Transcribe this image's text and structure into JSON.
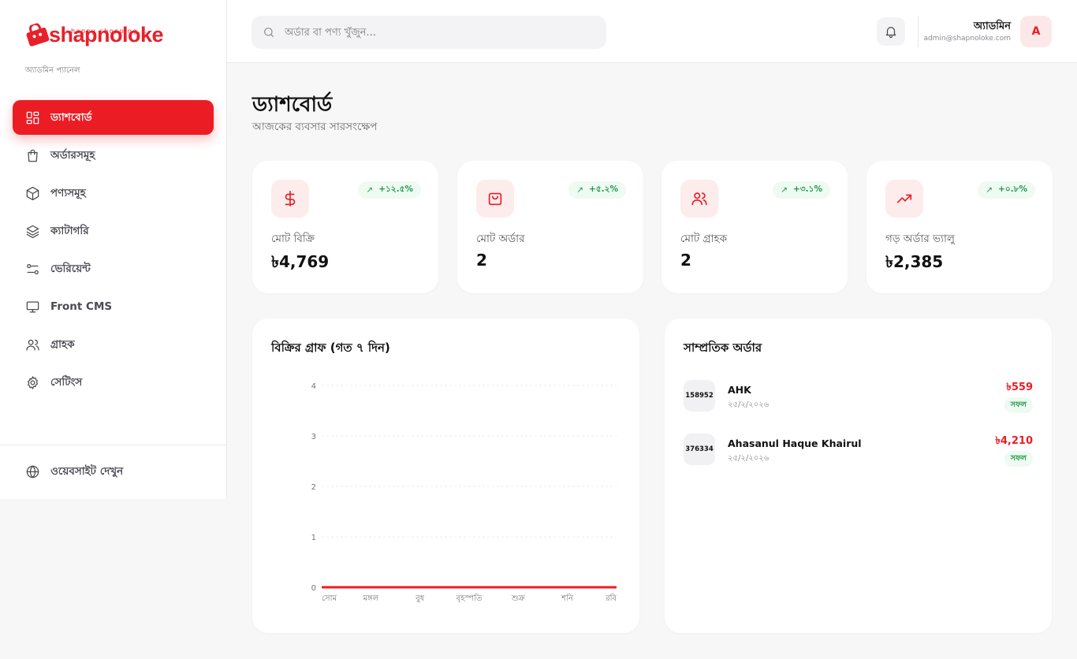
{
  "brand": {
    "name": "shapnoloke",
    "tagline": "happy shopping...",
    "panel_label": "অ্যাডমিন প্যানেল",
    "accent_color": "#ec1c24"
  },
  "sidebar": {
    "items": [
      {
        "label": "ড্যাশবোর্ড",
        "icon": "dashboard-grid-icon",
        "active": true
      },
      {
        "label": "অর্ডারসমূহ",
        "icon": "shopping-bag-icon",
        "active": false
      },
      {
        "label": "পণ্যসমূহ",
        "icon": "package-box-icon",
        "active": false
      },
      {
        "label": "ক্যাটাগরি",
        "icon": "layers-icon",
        "active": false
      },
      {
        "label": "ভেরিয়েন্ট",
        "icon": "variant-sliders-icon",
        "active": false
      },
      {
        "label": "Front CMS",
        "icon": "monitor-icon",
        "active": false
      },
      {
        "label": "গ্রাহক",
        "icon": "users-icon",
        "active": false
      },
      {
        "label": "সেটিংস",
        "icon": "gear-icon",
        "active": false
      }
    ],
    "visit_site": {
      "label": "ওয়েবসাইট দেখুন",
      "icon": "globe-icon"
    }
  },
  "header": {
    "search_placeholder": "অর্ডার বা পণ্য খুঁজুন...",
    "notification_icon": "bell-icon",
    "user": {
      "name": "অ্যাডমিন",
      "email": "admin@shapnoloke.com",
      "avatar_letter": "A"
    }
  },
  "page": {
    "title": "ড্যাশবোর্ড",
    "subtitle": "আজকের ব্যবসার সারসংক্ষেপ"
  },
  "stats": [
    {
      "label": "মোট বিক্রি",
      "value": "৳4,769",
      "trend": "+১২.৫%",
      "icon": "dollar-icon"
    },
    {
      "label": "মোট অর্ডার",
      "value": "2",
      "trend": "+৫.২%",
      "icon": "shopping-bag-icon"
    },
    {
      "label": "মোট গ্রাহক",
      "value": "2",
      "trend": "+৩.১%",
      "icon": "users-icon"
    },
    {
      "label": "গড় অর্ডার ভ্যালু",
      "value": "৳2,385",
      "trend": "+০.৮%",
      "icon": "trending-up-icon"
    }
  ],
  "chart_data": {
    "type": "line",
    "title": "বিক্রির গ্রাফ (গত ৭ দিন)",
    "categories": [
      "সোম",
      "মঙ্গল",
      "বুধ",
      "বৃহস্পতি",
      "শুক্র",
      "শনি",
      "রবি"
    ],
    "series": [
      {
        "values": [
          0,
          0,
          0,
          0,
          0,
          0,
          0
        ],
        "color": "#ec1c24"
      }
    ],
    "yticks": [
      0,
      1,
      2,
      3,
      4
    ],
    "ylim": [
      0,
      4
    ],
    "grid": true,
    "legend": "none"
  },
  "recent_orders": {
    "title": "সাম্প্রতিক অর্ডার",
    "items": [
      {
        "id": "158952",
        "customer": "AHK",
        "date": "২৫/২/২০২৬",
        "amount": "৳559",
        "status": "সফল"
      },
      {
        "id": "376334",
        "customer": "Ahasanul Haque Khairul",
        "date": "২৫/২/২০২৬",
        "amount": "৳4,210",
        "status": "সফল"
      }
    ]
  }
}
